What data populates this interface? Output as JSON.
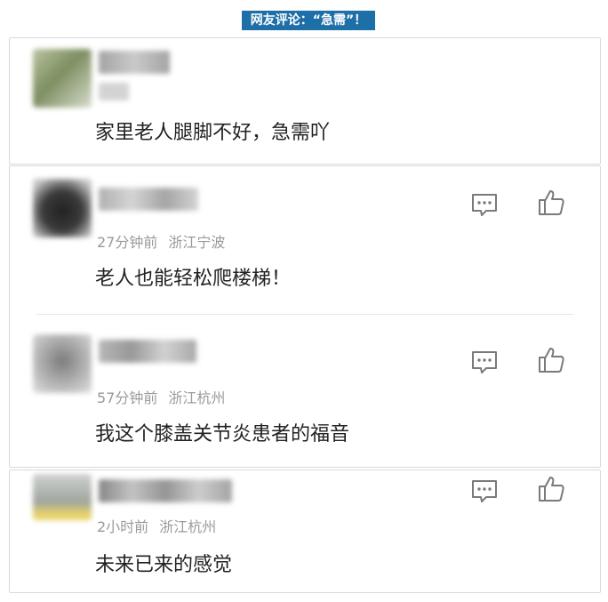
{
  "banner": {
    "title": "网友评论：“急需”！"
  },
  "comments": [
    {
      "user": "",
      "time": "",
      "location": "",
      "text": "家里老人腿脚不好，急需吖"
    },
    {
      "user": "",
      "time": "27分钟前",
      "location": "浙江宁波",
      "text": "老人也能轻松爬楼梯！"
    },
    {
      "user": "",
      "time": "57分钟前",
      "location": "浙江杭州",
      "text": "我这个膝盖关节炎患者的福音"
    },
    {
      "user": "",
      "time": "2小时前",
      "location": "浙江杭州",
      "text": "未来已来的感觉"
    }
  ],
  "icons": {
    "comment": "comment-bubble-icon",
    "like": "thumbs-up-icon"
  },
  "colors": {
    "banner_bg": "#1e6fa8",
    "text": "#222222",
    "meta": "#9a9a9a",
    "border": "#d9d9d9"
  }
}
